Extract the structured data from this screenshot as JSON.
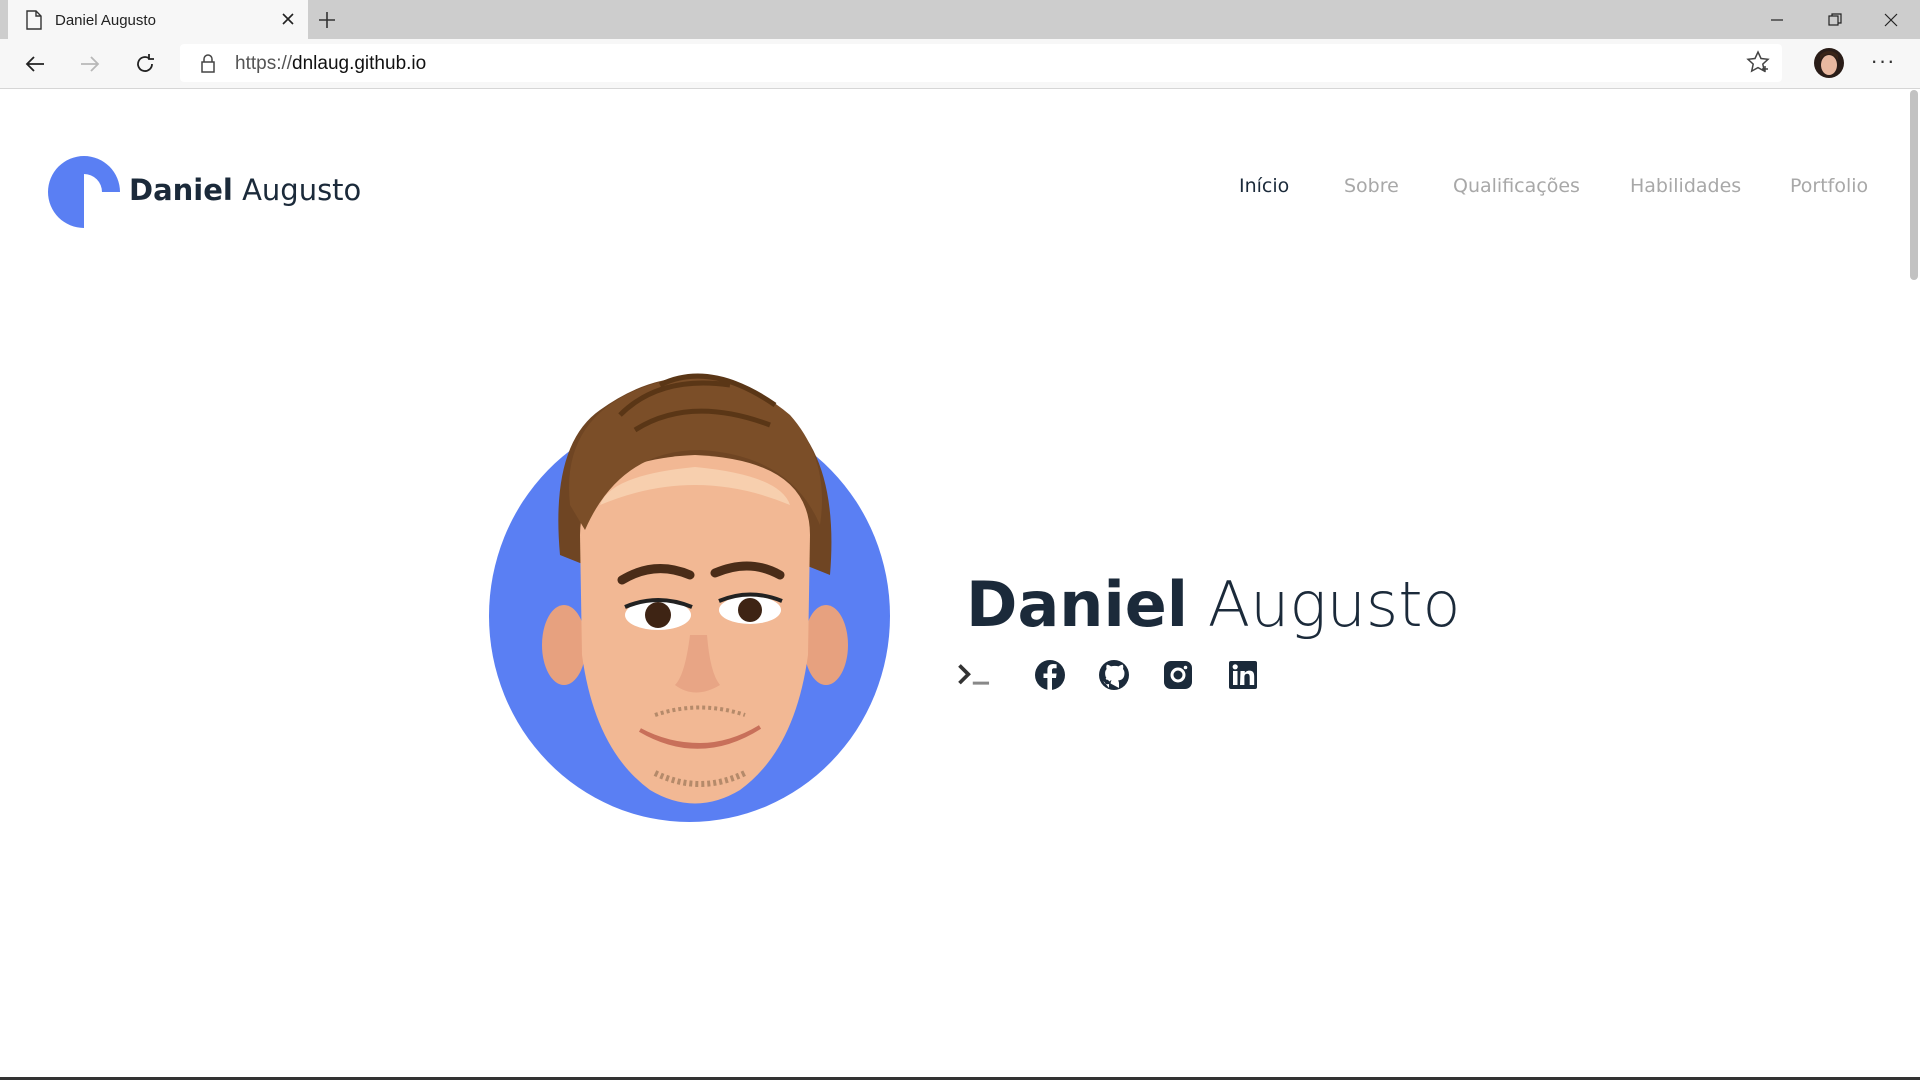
{
  "browser": {
    "tab_title": "Daniel Augusto",
    "url_prefix": "https://",
    "url_host": "dnlaug.github.io"
  },
  "site": {
    "logo_first": "Daniel",
    "logo_last": "Augusto",
    "nav": [
      "Início",
      "Sobre",
      "Qualificações",
      "Habilidades",
      "Portfolio"
    ],
    "active_nav": "Início",
    "hero_first": "Daniel",
    "hero_last": "Augusto",
    "social_icons": [
      "terminal-icon",
      "facebook-icon",
      "github-icon",
      "instagram-icon",
      "linkedin-icon"
    ]
  },
  "colors": {
    "accent": "#5a7ff3",
    "text_dark": "#1b2a3a",
    "nav_inactive": "#a8a8a8"
  }
}
